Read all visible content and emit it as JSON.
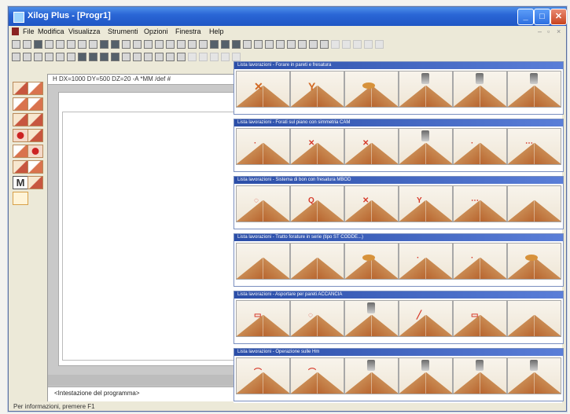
{
  "window": {
    "title": "Xilog Plus - [Progr1]"
  },
  "menu": [
    "File",
    "Modifica",
    "Visualizza",
    "Strumenti",
    "Opzioni",
    "Finestra",
    "Help"
  ],
  "editor": {
    "header": "H DX=1000 DY=500 DZ=20 -A *MM /def #",
    "footer": "<Intestazione del programma>"
  },
  "status": "Per informazioni, premere F1",
  "panels": [
    {
      "title": "Lista lavorazioni - Forare in pareti e fresatura",
      "thumbs": 6
    },
    {
      "title": "Lista lavorazioni - Forati sul piano con simmetria CAM",
      "thumbs": 6
    },
    {
      "title": "Lista lavorazioni - Sistema di bon con fresatura MBOD",
      "thumbs": 6
    },
    {
      "title": "Lista lavorazioni - Tratto forature in serie (tipo ST CODDE...)",
      "thumbs": 6
    },
    {
      "title": "Lista lavorazioni - Asportare per pareti ACCANCIA",
      "thumbs": 6
    },
    {
      "title": "Lista lavorazioni - Operazione sulle Hm",
      "thumbs": 6
    }
  ],
  "icons": {
    "close": "close-icon",
    "minimize": "minimize-icon",
    "maximize": "maximize-icon"
  }
}
